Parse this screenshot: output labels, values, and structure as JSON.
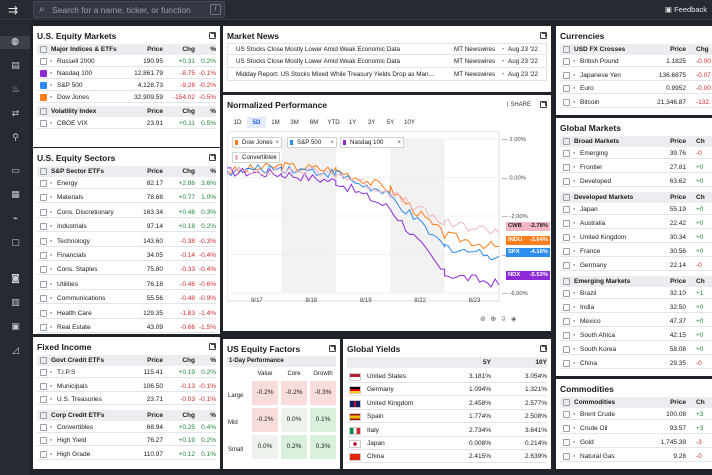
{
  "search": {
    "placeholder": "Search for a name, ticker, or function",
    "shortcut": "/"
  },
  "feedback": "Feedback",
  "equity": {
    "title": "U.S. Equity Markets",
    "groups": [
      {
        "header": [
          "Major Indices & ETFs",
          "Price",
          "Chg",
          "%"
        ],
        "rows": [
          {
            "name": "Russell 2000",
            "price": "190.95",
            "chg": "+0.31",
            "pct": "0.2%",
            "color": "",
            "dir": "pos"
          },
          {
            "name": "Nasdaq 100",
            "price": "12,861.79",
            "chg": "-8.75",
            "pct": "-0.1%",
            "color": "#8e2bd8",
            "dir": "neg"
          },
          {
            "name": "S&P 500",
            "price": "4,128.73",
            "chg": "-9.26",
            "pct": "-0.2%",
            "color": "#2d8cf0",
            "dir": "neg"
          },
          {
            "name": "Dow Jones",
            "price": "32,909.59",
            "chg": "-154.02",
            "pct": "-0.5%",
            "color": "#ff7d1a",
            "dir": "neg"
          }
        ]
      },
      {
        "header": [
          "Volatility Index",
          "Price",
          "Chg",
          "%"
        ],
        "rows": [
          {
            "name": "CBOE VIX",
            "price": "23.91",
            "chg": "+0.11",
            "pct": "0.5%",
            "color": "",
            "dir": "pos"
          }
        ]
      }
    ]
  },
  "sectors": {
    "title": "U.S. Equity Sectors",
    "header": [
      "S&P Sector ETFs",
      "Price",
      "Chg",
      "%"
    ],
    "rows": [
      {
        "name": "Energy",
        "price": "82.17",
        "chg": "+2.86",
        "pct": "3.6%",
        "dir": "pos"
      },
      {
        "name": "Materials",
        "price": "78.68",
        "chg": "+0.77",
        "pct": "1.0%",
        "dir": "pos"
      },
      {
        "name": "Cons. Discretionary",
        "price": "163.34",
        "chg": "+0.46",
        "pct": "0.3%",
        "dir": "pos"
      },
      {
        "name": "Industrials",
        "price": "97.14",
        "chg": "+0.18",
        "pct": "0.2%",
        "dir": "pos"
      },
      {
        "name": "Technology",
        "price": "143.60",
        "chg": "-0.38",
        "pct": "-0.3%",
        "dir": "neg"
      },
      {
        "name": "Financials",
        "price": "34.05",
        "chg": "-0.14",
        "pct": "-0.4%",
        "dir": "neg"
      },
      {
        "name": "Cons. Staples",
        "price": "75.80",
        "chg": "-0.33",
        "pct": "-0.4%",
        "dir": "neg"
      },
      {
        "name": "Utilities",
        "price": "76.18",
        "chg": "-0.46",
        "pct": "-0.6%",
        "dir": "neg"
      },
      {
        "name": "Communications",
        "price": "55.56",
        "chg": "-0.48",
        "pct": "-0.9%",
        "dir": "neg"
      },
      {
        "name": "Health Care",
        "price": "129.35",
        "chg": "-1.83",
        "pct": "-1.4%",
        "dir": "neg"
      },
      {
        "name": "Real Estate",
        "price": "43.09",
        "chg": "-0.66",
        "pct": "-1.5%",
        "dir": "neg"
      }
    ]
  },
  "fixed": {
    "title": "Fixed Income",
    "groups": [
      {
        "header": [
          "Govt Credit ETFs",
          "Price",
          "Chg",
          "%"
        ],
        "rows": [
          {
            "name": "T.I.P.S",
            "price": "115.41",
            "chg": "+0.19",
            "pct": "0.2%",
            "dir": "pos"
          },
          {
            "name": "Municipals",
            "price": "106.50",
            "chg": "-0.13",
            "pct": "-0.1%",
            "dir": "neg"
          },
          {
            "name": "U.S. Treasuries",
            "price": "23.71",
            "chg": "-0.03",
            "pct": "-0.1%",
            "dir": "neg"
          }
        ]
      },
      {
        "header": [
          "Corp Credit ETFs",
          "Price",
          "Chg",
          "%"
        ],
        "rows": [
          {
            "name": "Convertibles",
            "price": "68.94",
            "chg": "+0.25",
            "pct": "0.4%",
            "dir": "pos"
          },
          {
            "name": "High Yield",
            "price": "76.27",
            "chg": "+0.19",
            "pct": "0.2%",
            "dir": "pos"
          },
          {
            "name": "High Grade",
            "price": "110.97",
            "chg": "+0.12",
            "pct": "0.1%",
            "dir": "pos"
          }
        ]
      }
    ]
  },
  "news": {
    "title": "Market News",
    "items": [
      {
        "headline": "US Stocks Close Mostly Lower Amid Weak Economic Data",
        "source": "MT Newswires",
        "date": "Aug 23 '22"
      },
      {
        "headline": "US Stocks Close Mostly Lower Amid Weak Economic Data",
        "source": "MT Newswires",
        "date": "Aug 23 '22"
      },
      {
        "headline": "Midday Report: US Stocks Mixed While Treasury Yields Drop as Man...",
        "source": "MT Newswires",
        "date": "Aug 23 '22"
      }
    ]
  },
  "perf": {
    "title": "Normalized Performance",
    "share": "SHARE",
    "ranges": [
      "1D",
      "5D",
      "1M",
      "3M",
      "6M",
      "YTD",
      "1Y",
      "3Y",
      "5Y",
      "10Y"
    ],
    "selected_range": "5D",
    "chips": [
      {
        "label": "Dow Jones",
        "color": "#ff7d1a"
      },
      {
        "label": "S&P 500",
        "color": "#2d8cf0"
      },
      {
        "label": "Nasdaq 100",
        "color": "#8e2bd8"
      },
      {
        "label": "Convertibles",
        "color": "#f4b6c2"
      }
    ],
    "end_labels": [
      {
        "label": "CWB",
        "value": "-2.78%",
        "color": "#f4b6c2",
        "text": "#222"
      },
      {
        "label": "INDU",
        "value": "-3.64%",
        "color": "#ff7d1a",
        "text": "#fff"
      },
      {
        "label": "SPX",
        "value": "-4.10%",
        "color": "#2d8cf0",
        "text": "#fff"
      },
      {
        "label": "NDX",
        "value": "-5.53%",
        "color": "#8e2bd8",
        "text": "#fff"
      }
    ]
  },
  "chart_data": {
    "type": "line",
    "x": [
      "8/17",
      "8/18",
      "8/19",
      "8/22",
      "8/23"
    ],
    "y_ticks": [
      "2.00%",
      "0.00%",
      "-2.00%",
      "-4.00%",
      "-6.00%"
    ],
    "ylim": [
      -6,
      2
    ],
    "series": [
      {
        "name": "Dow Jones",
        "values": [
          0.6,
          0.4,
          -0.6,
          -3.0,
          -3.64
        ]
      },
      {
        "name": "S&P 500",
        "values": [
          0.5,
          0.2,
          -1.0,
          -3.6,
          -4.1
        ]
      },
      {
        "name": "Nasdaq 100",
        "values": [
          0.2,
          -0.2,
          -1.6,
          -5.0,
          -5.53
        ]
      },
      {
        "name": "Convertibles",
        "values": [
          0.4,
          0.2,
          -0.8,
          -2.4,
          -2.78
        ]
      }
    ]
  },
  "factors": {
    "title": "US Equity Factors",
    "subtitle": "1-Day Performance",
    "cols": [
      "Value",
      "Core",
      "Growth"
    ],
    "rows": [
      {
        "label": "Large",
        "vals": [
          "-0.2%",
          "-0.2%",
          "-0.3%"
        ]
      },
      {
        "label": "Mid",
        "vals": [
          "-0.2%",
          "0.0%",
          "0.1%"
        ]
      },
      {
        "label": "Small",
        "vals": [
          "0.0%",
          "0.2%",
          "0.3%"
        ]
      }
    ]
  },
  "yields": {
    "title": "Global Yields",
    "cols": [
      "5Y",
      "10Y"
    ],
    "rows": [
      {
        "country": "United States",
        "y5": "3.181%",
        "y10": "3.054%"
      },
      {
        "country": "Germany",
        "y5": "1.094%",
        "y10": "1.321%"
      },
      {
        "country": "United Kingdom",
        "y5": "2.458%",
        "y10": "2.577%"
      },
      {
        "country": "Spain",
        "y5": "1.774%",
        "y10": "2.508%"
      },
      {
        "country": "Italy",
        "y5": "2.734%",
        "y10": "3.641%"
      },
      {
        "country": "Japan",
        "y5": "0.008%",
        "y10": "0.214%"
      },
      {
        "country": "China",
        "y5": "2.415%",
        "y10": "2.639%"
      }
    ]
  },
  "currencies": {
    "title": "Currencies",
    "header": [
      "USD FX Crosses",
      "Price",
      "Chg"
    ],
    "rows": [
      {
        "name": "British Pound",
        "price": "1.1825",
        "chg": "-0.00"
      },
      {
        "name": "Japanese Yen",
        "price": "136.6875",
        "chg": "-0.07"
      },
      {
        "name": "Euro",
        "price": "0.9952",
        "chg": "-0.00"
      },
      {
        "name": "Bitcoin",
        "price": "21,346.87",
        "chg": "-132."
      }
    ]
  },
  "markets": {
    "title": "Global Markets",
    "groups": [
      {
        "header": [
          "Broad Markets",
          "Price",
          "Ch"
        ],
        "rows": [
          {
            "name": "Emerging",
            "price": "39.76",
            "chg": "-0"
          },
          {
            "name": "Frontier",
            "price": "27.81",
            "chg": "+0"
          },
          {
            "name": "Developed",
            "price": "63.62",
            "chg": "+0"
          }
        ]
      },
      {
        "header": [
          "Developed Markets",
          "Price",
          "Ch"
        ],
        "rows": [
          {
            "name": "Japan",
            "price": "55.19",
            "chg": "+0"
          },
          {
            "name": "Australia",
            "price": "22.42",
            "chg": "+0"
          },
          {
            "name": "United Kingdom",
            "price": "30.34",
            "chg": "+0"
          },
          {
            "name": "France",
            "price": "30.56",
            "chg": "+0"
          },
          {
            "name": "Germany",
            "price": "22.14",
            "chg": "-0"
          }
        ]
      },
      {
        "header": [
          "Emerging Markets",
          "Price",
          "Ch"
        ],
        "rows": [
          {
            "name": "Brazil",
            "price": "32.10",
            "chg": "+1"
          },
          {
            "name": "India",
            "price": "32.50",
            "chg": "+0"
          },
          {
            "name": "Mexico",
            "price": "47.37",
            "chg": "+0"
          },
          {
            "name": "South Africa",
            "price": "42.15",
            "chg": "+0"
          },
          {
            "name": "South Korea",
            "price": "58.08",
            "chg": "+0"
          },
          {
            "name": "China",
            "price": "29.35",
            "chg": "-0"
          }
        ]
      }
    ]
  },
  "commodities": {
    "title": "Commodities",
    "header": [
      "Commodities",
      "Price",
      "Ch"
    ],
    "rows": [
      {
        "name": "Brent Crude",
        "price": "100.08",
        "chg": "+3"
      },
      {
        "name": "Crude Oil",
        "price": "93.57",
        "chg": "+3"
      },
      {
        "name": "Gold",
        "price": "1,745.39",
        "chg": "-3"
      },
      {
        "name": "Natural Gas",
        "price": "9.28",
        "chg": "-0"
      }
    ]
  }
}
